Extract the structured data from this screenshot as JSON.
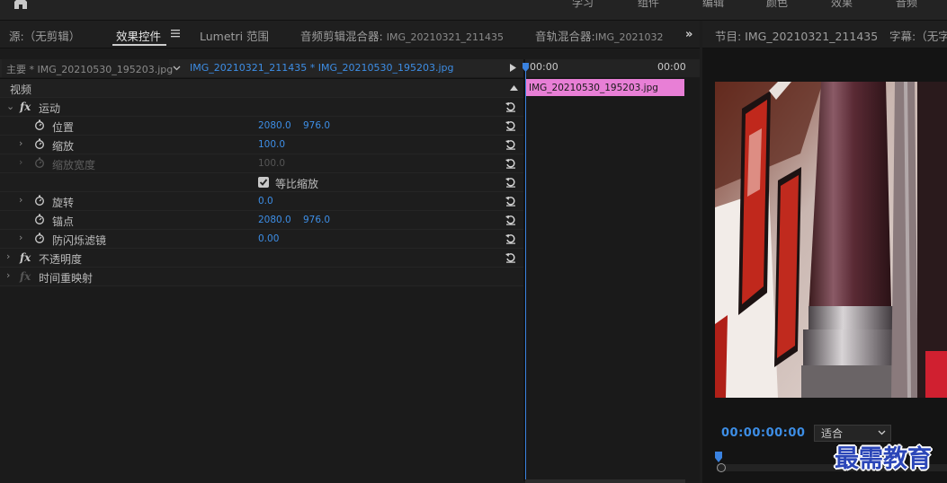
{
  "workspaces": [
    "学习",
    "组件",
    "编辑",
    "颜色",
    "效果",
    "音频"
  ],
  "tabs": {
    "source": "源:（无剪辑）",
    "effect_controls": "效果控件",
    "lumetri": "Lumetri 范围",
    "audio_clip_mixer": "音频剪辑混合器:",
    "audio_clip_mixer_sub": "IMG_20210321_211435",
    "audio_track_mixer": "音轨混合器:",
    "audio_track_mixer_sub": "IMG_2021032",
    "more": "»"
  },
  "program": {
    "title": "节目: IMG_20210321_211435",
    "captions": "字幕:（无字",
    "timecode": "00:00:00:00",
    "fit": "适合"
  },
  "clipbar": {
    "master": "主要 * IMG_20210530_195203.jpg",
    "sequence": "IMG_20210321_211435 * IMG_20210530_195203.jpg"
  },
  "timeline": {
    "start_time": "00:00",
    "end_time": "00:00",
    "clip_name": "IMG_20210530_195203.jpg"
  },
  "effects": {
    "video_header": "视频",
    "motion": "运动",
    "position": "位置",
    "position_x": "2080.0",
    "position_y": "976.0",
    "scale": "缩放",
    "scale_value": "100.0",
    "scale_width": "缩放宽度",
    "scale_width_value": "100.0",
    "uniform_scale": "等比缩放",
    "rotation": "旋转",
    "rotation_value": "0.0",
    "anchor": "锚点",
    "anchor_x": "2080.0",
    "anchor_y": "976.0",
    "anti_flicker": "防闪烁滤镜",
    "anti_flicker_value": "0.00",
    "opacity": "不透明度",
    "time_remap": "时间重映射",
    "fx": "fx"
  },
  "watermark": "最需教育",
  "colors": {
    "accent_blue": "#3d8ee6",
    "clip_pink": "#e87fd6"
  }
}
